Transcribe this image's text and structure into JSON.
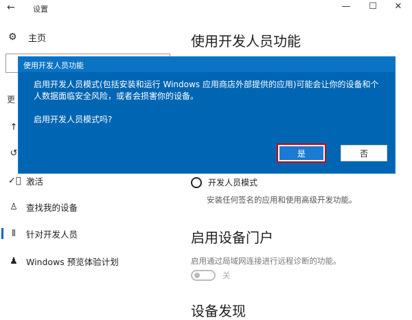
{
  "window": {
    "title": "设置",
    "controls": {
      "minimize": "—",
      "maximize": "☐",
      "close": "✕"
    }
  },
  "sidebar": {
    "home": {
      "label": "主页",
      "icon": "gear-icon"
    },
    "section_header": "更",
    "items": [
      {
        "label": "",
        "icon": "upload-arrow-icon"
      },
      {
        "label": "",
        "icon": "history-icon"
      },
      {
        "label": "激活",
        "icon": "check-circle-icon"
      },
      {
        "label": "查找我的设备",
        "icon": "person-icon"
      },
      {
        "label": "针对开发人员",
        "icon": "developer-bars-icon",
        "selected": true
      },
      {
        "label": "Windows 预览体验计划",
        "icon": "insider-icon"
      }
    ]
  },
  "main": {
    "title": "使用开发人员功能",
    "dev_mode_option": "开发人员模式",
    "dev_mode_desc": "安装任何签名的应用和使用高级开发功能。",
    "portal_title": "启用设备门户",
    "portal_desc": "启用通过局域网连接进行远程诊断的功能。",
    "portal_toggle_label": "关",
    "portal_toggle_on": false,
    "discovery_title": "设备发现"
  },
  "dialog": {
    "title": "使用开发人员功能",
    "message": "启用开发人员模式(包括安装和运行 Windows 应用商店外部提供的应用)可能会让你的设备和个人数据面临安全风险，或者会损害你的设备。",
    "question": "启用开发人员模式吗?",
    "yes_label": "是",
    "no_label": "否"
  },
  "colors": {
    "dialog_bg": "#0065b3",
    "highlight": "#d40000",
    "accent": "#0067c0"
  }
}
